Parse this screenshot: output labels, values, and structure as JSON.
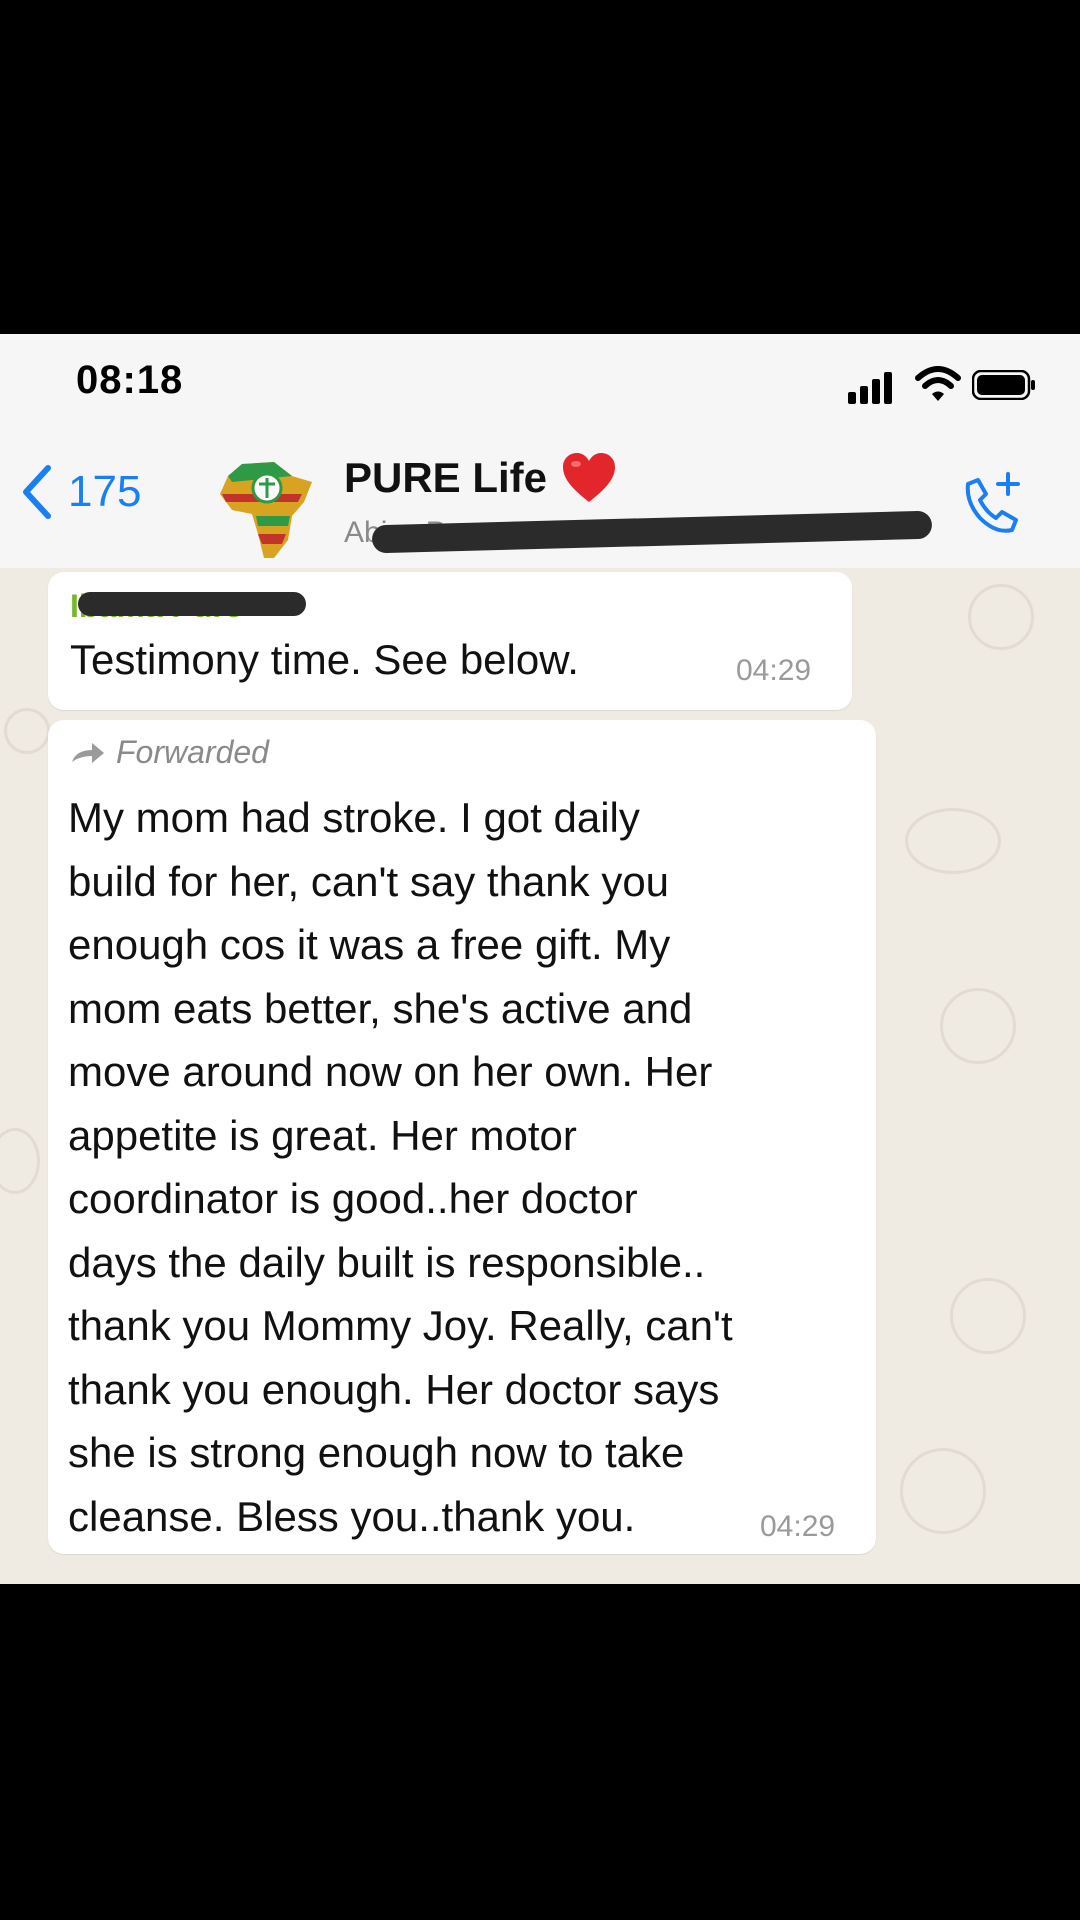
{
  "status_bar": {
    "time": "08:18"
  },
  "header": {
    "back_count": "175",
    "title": "PURE Life",
    "subtitle": "Abi… Pure, Accountant Lawman...",
    "heart_icon": "red-heart-icon",
    "call_icon": "add-call-icon"
  },
  "messages": [
    {
      "sender": "Ibama Pure",
      "text": "Testimony time. See below.",
      "time": "04:29"
    },
    {
      "forwarded_label": "Forwarded",
      "lines": [
        "My mom had stroke. I got daily",
        "build for her, can't say thank you",
        "enough cos it was a free gift. My",
        "mom eats better, she's active and",
        "move around now on her own. Her",
        "appetite is great. Her motor",
        "coordinator is good..her doctor",
        "days the daily built is responsible..",
        "thank you Mommy Joy. Really, can't",
        "thank you enough. Her doctor says",
        "she is strong enough now to take",
        "cleanse. Bless you..thank you."
      ],
      "time": "04:29"
    }
  ],
  "colors": {
    "accent_blue": "#1a7ff3",
    "sender_green": "#76b82a",
    "chat_background": "#efeae2"
  }
}
